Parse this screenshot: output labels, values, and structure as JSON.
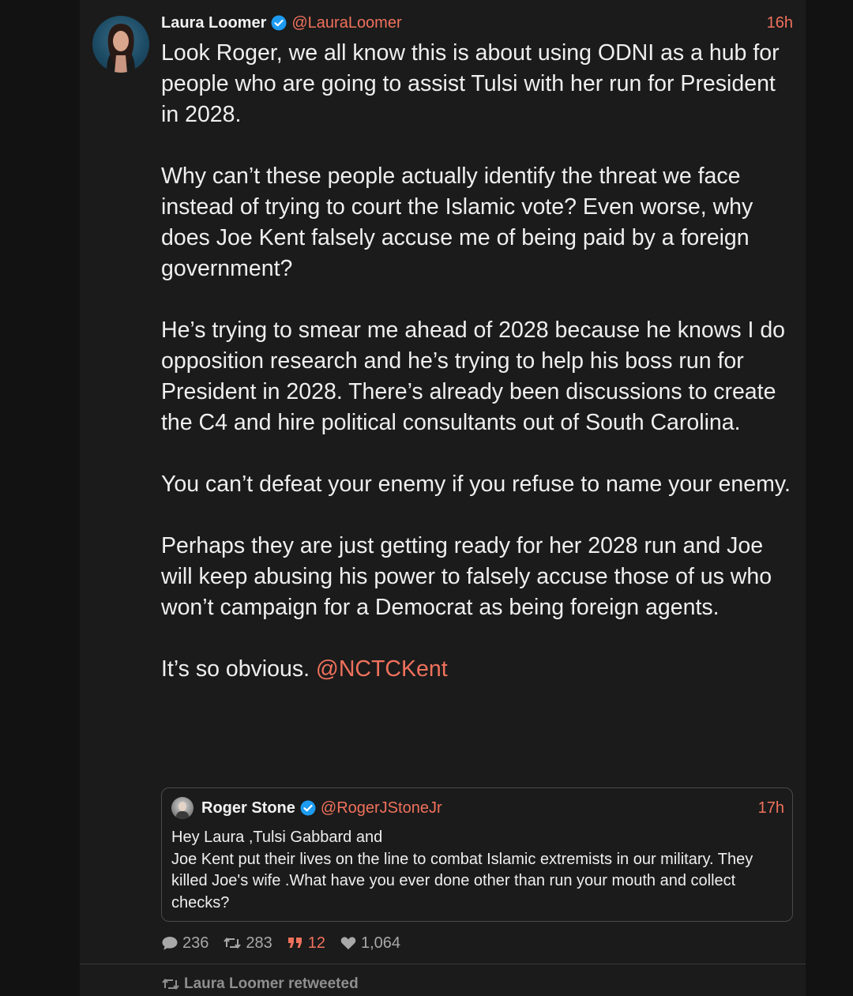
{
  "tweet": {
    "author_name": "Laura Loomer",
    "handle": "@LauraLoomer",
    "time": "16h",
    "paragraphs": [
      "Look Roger, we all know this is about using ODNI as a hub for people who are going to assist Tulsi with her run for President in 2028.",
      "Why can’t these people actually identify the threat we face instead of trying to court the Islamic vote? Even worse, why does Joe Kent falsely accuse me of being paid by a foreign government?",
      "He’s trying to smear me ahead of 2028 because he knows I do opposition research and he’s trying to help his boss run for President in 2028. There’s already been discussions to create the C4 and hire political consultants out of South Carolina.",
      "You can’t defeat your enemy if you refuse to name your enemy.",
      "Perhaps they are just getting ready for her 2028 run and Joe will keep abusing his power to falsely accuse those of us who won’t campaign for a Democrat as being foreign agents."
    ],
    "last_line_text": "It’s so obvious. ",
    "last_line_mention": "@NCTCKent"
  },
  "quoted": {
    "author_name": "Roger Stone",
    "handle": "@RogerJStoneJr",
    "time": "17h",
    "text": "Hey Laura ,Tulsi Gabbard and\n Joe Kent  put their lives on the line to combat Islamic extremists in our military. They killed Joe's  wife .What have you ever done other than run your mouth and collect checks?"
  },
  "stats": {
    "replies": "236",
    "retweets": "283",
    "quotes": "12",
    "likes": "1,064"
  },
  "next_item": {
    "retweeted_label": "Laura Loomer retweeted"
  },
  "colors": {
    "accent": "#f0715c",
    "verified": "#1d9bf0",
    "background": "#1b1b1b"
  },
  "icons": [
    "verified-badge-icon",
    "reply-icon",
    "retweet-icon",
    "quote-icon",
    "like-icon"
  ]
}
